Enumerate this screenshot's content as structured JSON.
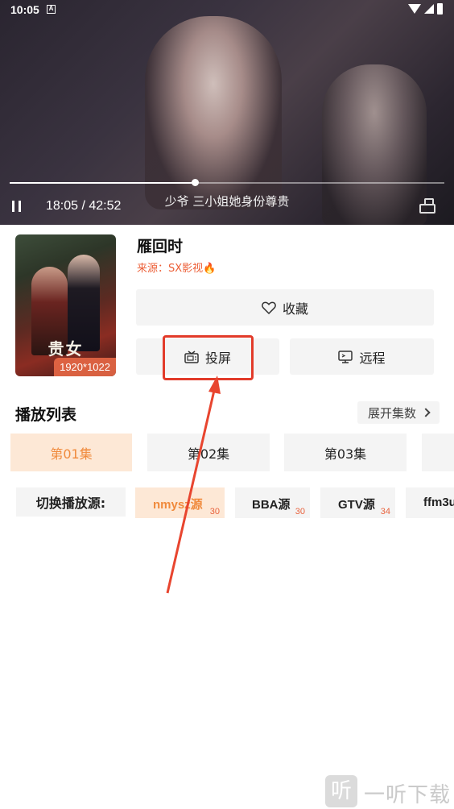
{
  "status_bar": {
    "time": "10:05",
    "a_icon": "A"
  },
  "player": {
    "progress_fraction": 0.425,
    "time": "18:05 / 42:52",
    "subtitle": "少爷 三小姐她身份尊贵"
  },
  "movie": {
    "poster_title": "贵女",
    "poster_badge": "1920*1022",
    "title": "雁回时",
    "source": "来源：SX影视🔥"
  },
  "actions": {
    "favorite": "收藏",
    "cast": "投屏",
    "remote": "远程"
  },
  "playlist": {
    "title": "播放列表",
    "expand": "展开集数",
    "episodes": [
      "第01集",
      "第02集",
      "第03集"
    ]
  },
  "sources": {
    "label": "切换播放源:",
    "items": [
      {
        "name": "nmysz源",
        "count": "30"
      },
      {
        "name": "BBA源",
        "count": "30"
      },
      {
        "name": "GTV源",
        "count": "34"
      },
      {
        "name": "ffm3u",
        "count": ""
      }
    ]
  },
  "watermark": {
    "logo": "听",
    "text": "一听下载"
  },
  "colors": {
    "accent": "#f08a3c",
    "highlight": "#e23b2a",
    "source_text": "#ec5e36"
  }
}
